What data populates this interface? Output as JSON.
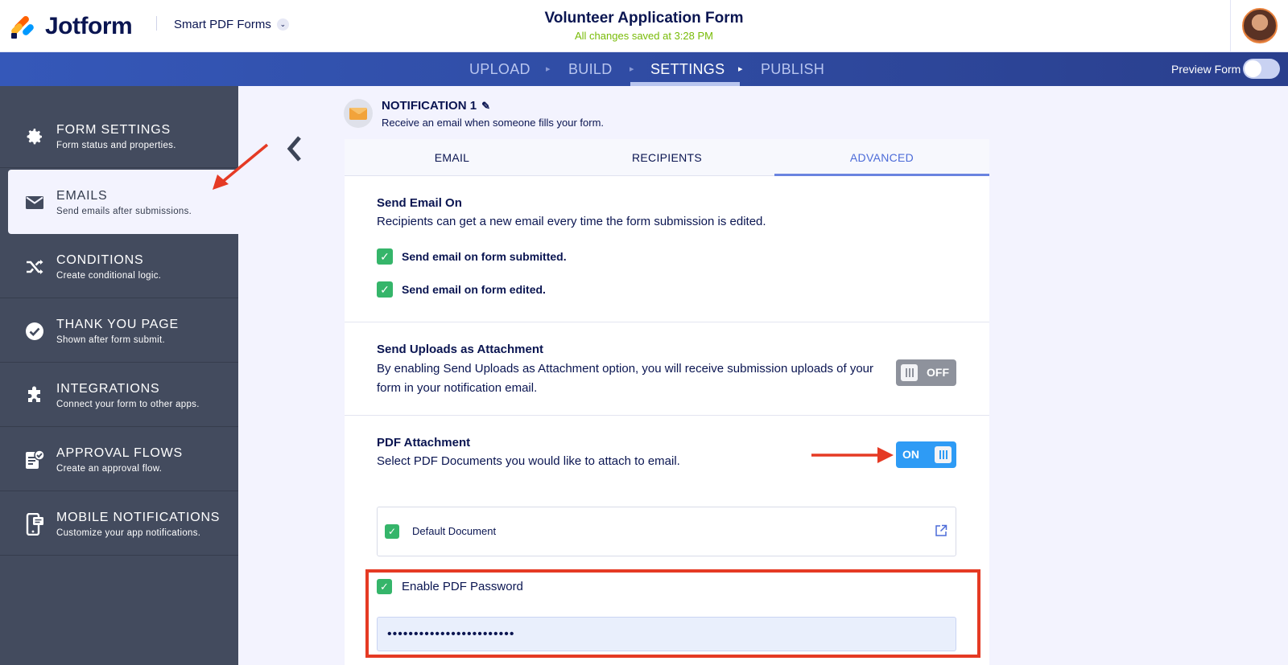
{
  "header": {
    "brand": "Jotform",
    "product_switcher": "Smart PDF Forms",
    "form_title": "Volunteer Application Form",
    "save_status": "All changes saved at 3:28 PM"
  },
  "navbar": {
    "steps": [
      "UPLOAD",
      "BUILD",
      "SETTINGS",
      "PUBLISH"
    ],
    "active_step": "SETTINGS",
    "preview_label": "Preview Form"
  },
  "sidebar": {
    "items": [
      {
        "title": "FORM SETTINGS",
        "subtitle": "Form status and properties.",
        "icon": "gear-icon"
      },
      {
        "title": "EMAILS",
        "subtitle": "Send emails after submissions.",
        "icon": "envelope-icon"
      },
      {
        "title": "CONDITIONS",
        "subtitle": "Create conditional logic.",
        "icon": "shuffle-icon"
      },
      {
        "title": "THANK YOU PAGE",
        "subtitle": "Shown after form submit.",
        "icon": "check-circle-icon"
      },
      {
        "title": "INTEGRATIONS",
        "subtitle": "Connect your form to other apps.",
        "icon": "puzzle-icon"
      },
      {
        "title": "APPROVAL FLOWS",
        "subtitle": "Create an approval flow.",
        "icon": "approval-icon"
      },
      {
        "title": "MOBILE NOTIFICATIONS",
        "subtitle": "Customize your app notifications.",
        "icon": "mobile-icon"
      }
    ],
    "active_item": "EMAILS"
  },
  "notification": {
    "title": "NOTIFICATION 1",
    "subtitle": "Receive an email when someone fills your form."
  },
  "tabs": {
    "labels": [
      "EMAIL",
      "RECIPIENTS",
      "ADVANCED"
    ],
    "active": "ADVANCED"
  },
  "send_email_on": {
    "title": "Send Email On",
    "description": "Recipients can get a new email every time the form submission is edited.",
    "options": [
      "Send email on form submitted.",
      "Send email on form edited."
    ]
  },
  "uploads_attachment": {
    "title": "Send Uploads as Attachment",
    "description": "By enabling Send Uploads as Attachment option, you will receive submission uploads of your form in your notification email.",
    "toggle_label": "OFF"
  },
  "pdf_attachment": {
    "title": "PDF Attachment",
    "description": "Select PDF Documents you would like to attach to email.",
    "toggle_label": "ON",
    "document_name": "Default Document",
    "password_option_label": "Enable PDF Password",
    "password_value": "••••••••••••••••••••••••"
  },
  "colors": {
    "brand_navy": "#0a1551",
    "nav_blue": "#3558b9",
    "sidebar_bg": "#434b5e",
    "check_green": "#35b56a",
    "toggle_on": "#2e9bf5",
    "toggle_off": "#8e929c",
    "saved_green": "#78bb07",
    "annotation_red": "#e53a24"
  }
}
